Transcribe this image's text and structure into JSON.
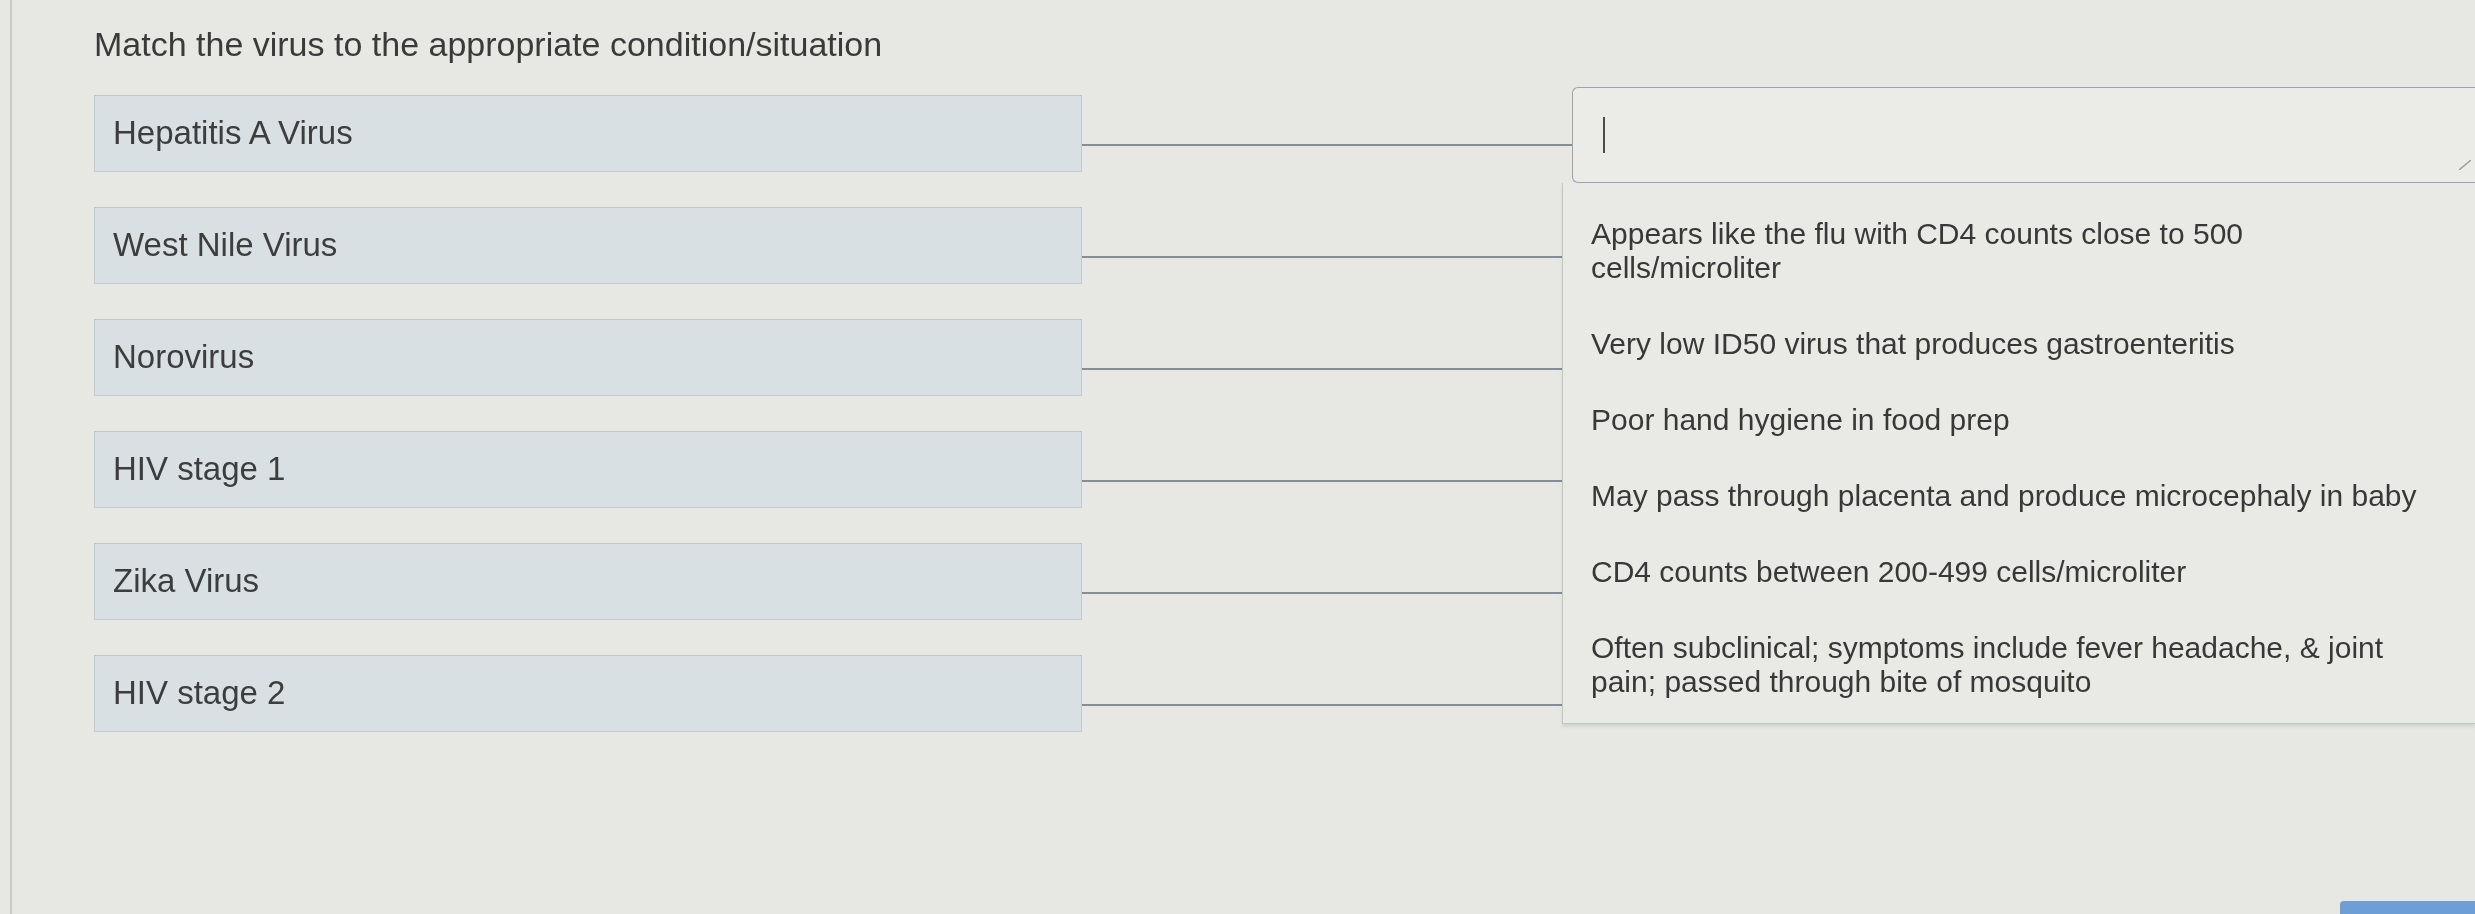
{
  "question": "Match the virus to the appropriate condition/situation",
  "pairs": [
    {
      "prompt": "Hepatitis A Virus",
      "expanded": true
    },
    {
      "prompt": "West Nile Virus",
      "expanded": false
    },
    {
      "prompt": "Norovirus",
      "expanded": false
    },
    {
      "prompt": "HIV stage 1",
      "expanded": false
    },
    {
      "prompt": "Zika Virus",
      "expanded": false
    },
    {
      "prompt": "HIV stage 2",
      "expanded": false
    }
  ],
  "dropdown_options": [
    "Appears like the flu with CD4 counts close to 500 cells/microliter",
    "Very low ID50 virus that produces gastroenteritis",
    "Poor hand hygiene in food prep",
    "May pass through placenta and produce microcephaly in baby",
    "CD4 counts between 200-499 cells/microliter",
    "Often subclinical; symptoms include fever headache, & joint pain; passed through bite of mosquito"
  ]
}
